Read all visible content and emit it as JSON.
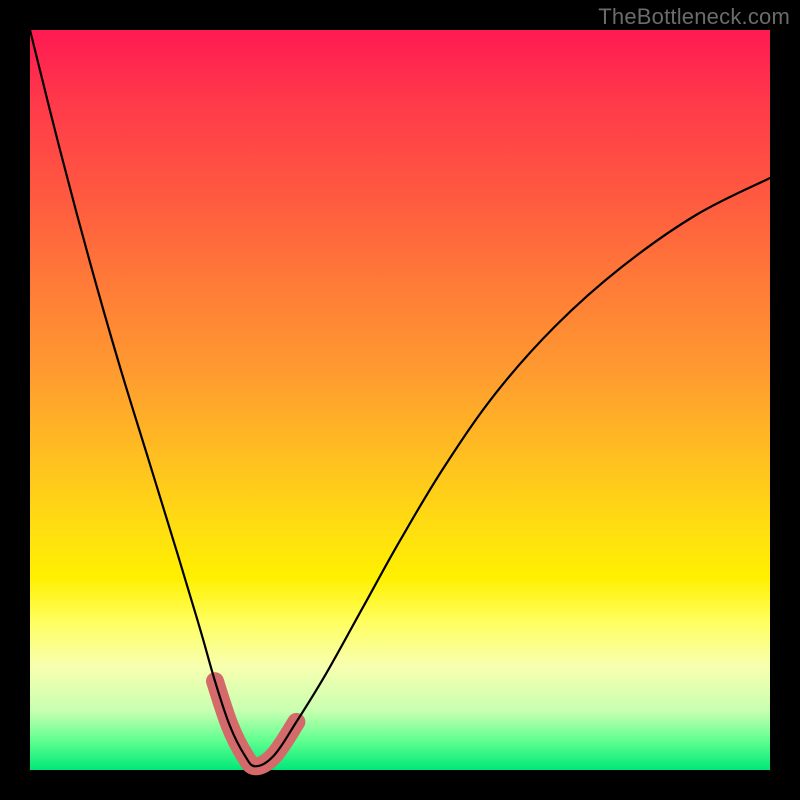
{
  "watermark": "TheBottleneck.com",
  "colors": {
    "frame": "#000000",
    "gradient_top": "#ff1a52",
    "gradient_bottom": "#00e878",
    "curve": "#000000",
    "highlight": "#d46a6a"
  },
  "chart_data": {
    "type": "line",
    "title": "",
    "xlabel": "",
    "ylabel": "",
    "xlim": [
      0,
      100
    ],
    "ylim": [
      0,
      100
    ],
    "series": [
      {
        "name": "bottleneck-curve",
        "x": [
          0,
          4,
          8,
          12,
          16,
          20,
          23,
          25,
          27,
          29,
          30.5,
          33,
          36,
          40,
          45,
          50,
          56,
          63,
          71,
          80,
          90,
          100
        ],
        "y": [
          100,
          84,
          69,
          55,
          42,
          29,
          19,
          12,
          6,
          2,
          0.5,
          2,
          6.5,
          13,
          22,
          31,
          41,
          51,
          60,
          68,
          75,
          80
        ]
      }
    ],
    "highlight": {
      "name": "valley-highlight",
      "x": [
        25,
        27,
        29,
        30.5,
        33,
        36
      ],
      "y": [
        12,
        6,
        2,
        0.5,
        2,
        6.5
      ]
    }
  }
}
